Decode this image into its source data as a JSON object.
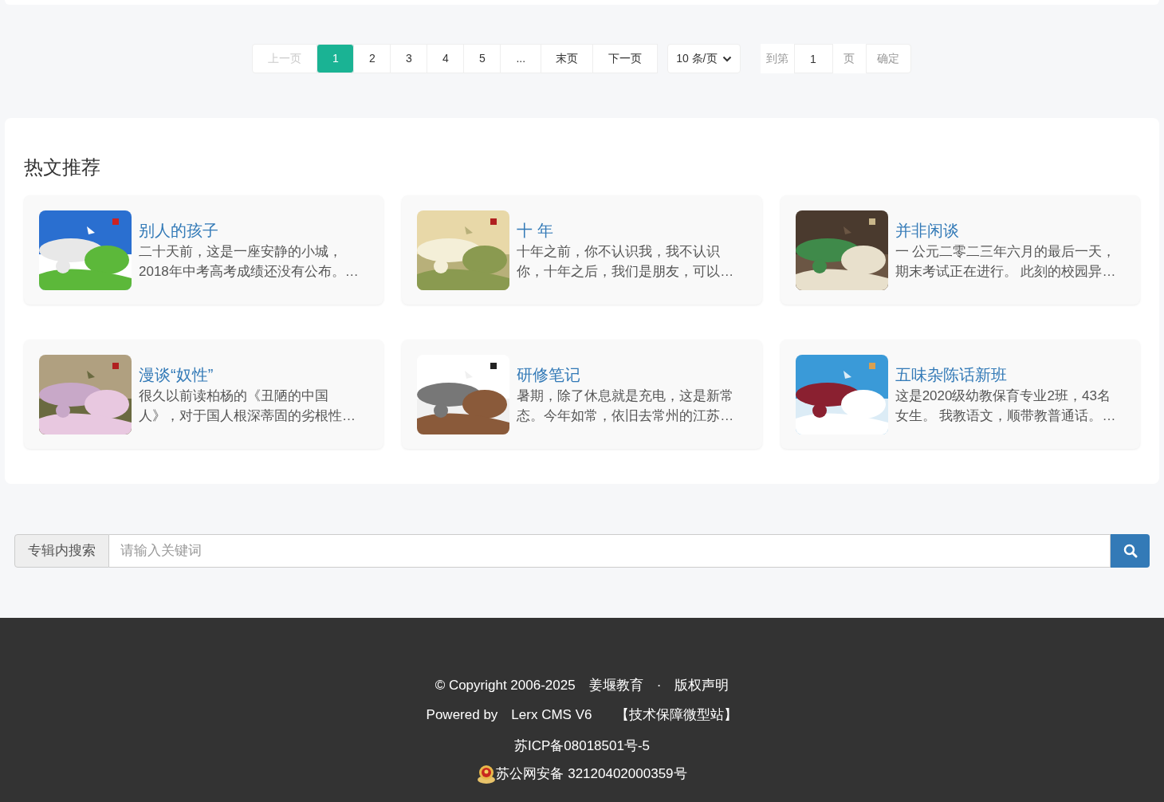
{
  "pagination": {
    "pages": [
      {
        "label": "上一页",
        "selected": false,
        "disabled": true
      },
      {
        "label": "1",
        "selected": true,
        "disabled": false
      },
      {
        "label": "2",
        "selected": false,
        "disabled": false
      },
      {
        "label": "3",
        "selected": false,
        "disabled": false
      },
      {
        "label": "4",
        "selected": false,
        "disabled": false
      },
      {
        "label": "5",
        "selected": false,
        "disabled": false
      },
      {
        "label": "...",
        "selected": false,
        "disabled": false
      },
      {
        "label": "末页",
        "selected": false,
        "disabled": false
      },
      {
        "label": "下一页",
        "selected": false,
        "disabled": false
      }
    ],
    "page_size": "10 条/页",
    "goto_label": "到第",
    "goto_value": "1",
    "page_unit": "页",
    "confirm": "确定"
  },
  "hot_articles": {
    "title": "热文推荐",
    "items": [
      {
        "title": "别人的孩子",
        "summary": "二十天前，这是一座安静的小城，2018年中考高考成绩还没有公布。…"
      },
      {
        "title": "十 年",
        "summary": "十年之前，你不认识我，我不认识你，十年之后，我们是朋友，可以…"
      },
      {
        "title": "并非闲谈",
        "summary": "一 公元二零二三年六月的最后一天，期末考试正在进行。 此刻的校园异…"
      },
      {
        "title": "漫谈“奴性”",
        "summary": "很久以前读柏杨的《丑陋的中国人》，对于国人根深蒂固的劣根性…"
      },
      {
        "title": "研修笔记",
        "summary": "暑期，除了休息就是充电，这是新常态。今年如常，依旧去常州的江苏…"
      },
      {
        "title": "五味杂陈话新班",
        "summary": "这是2020级幼教保育专业2班，43名女生。 我教语文，顺带教普通话。…"
      }
    ]
  },
  "search": {
    "label": "专辑内搜索",
    "placeholder": "请输入关键词"
  },
  "footer": {
    "copyright": "© Copyright 2006-2025",
    "org": "姜堰教育",
    "separator": "·",
    "rights_link": "版权声明",
    "powered_by": "Powered by",
    "cms_link": "Lerx CMS V6",
    "support_link": "【技术保障微型站】",
    "icp": "苏ICP备08018501号-5",
    "police": "苏公网安备 32120402000359号"
  }
}
